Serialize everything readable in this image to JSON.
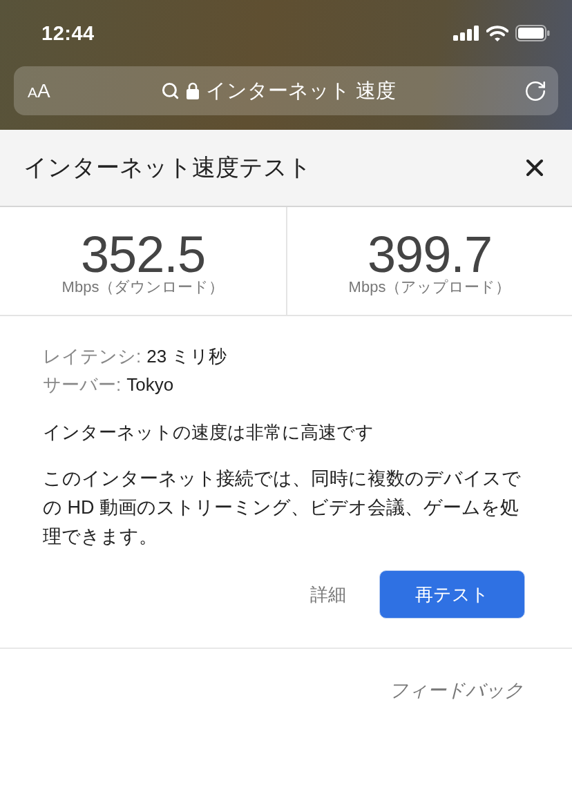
{
  "status_bar": {
    "time": "12:44"
  },
  "address_bar": {
    "text_size_button": "AA",
    "address": "インターネット 速度"
  },
  "panel": {
    "title": "インターネット速度テスト"
  },
  "speeds": [
    {
      "value": "352.5",
      "unit": "Mbps（ダウンロード）"
    },
    {
      "value": "399.7",
      "unit": "Mbps（アップロード）"
    }
  ],
  "details": [
    {
      "label": "レイテンシ:",
      "value": "23 ミリ秒"
    },
    {
      "label": "サーバー:",
      "value": "Tokyo"
    }
  ],
  "verdict": "インターネットの速度は非常に高速です",
  "description": "このインターネット接続では、同時に複数のデバイスでの HD 動画のストリーミング、ビデオ会議、ゲームを処理できます。",
  "actions": [
    {
      "kind": "link",
      "label": "詳細"
    },
    {
      "kind": "primary",
      "label": "再テスト"
    }
  ],
  "feedback": "フィードバック"
}
